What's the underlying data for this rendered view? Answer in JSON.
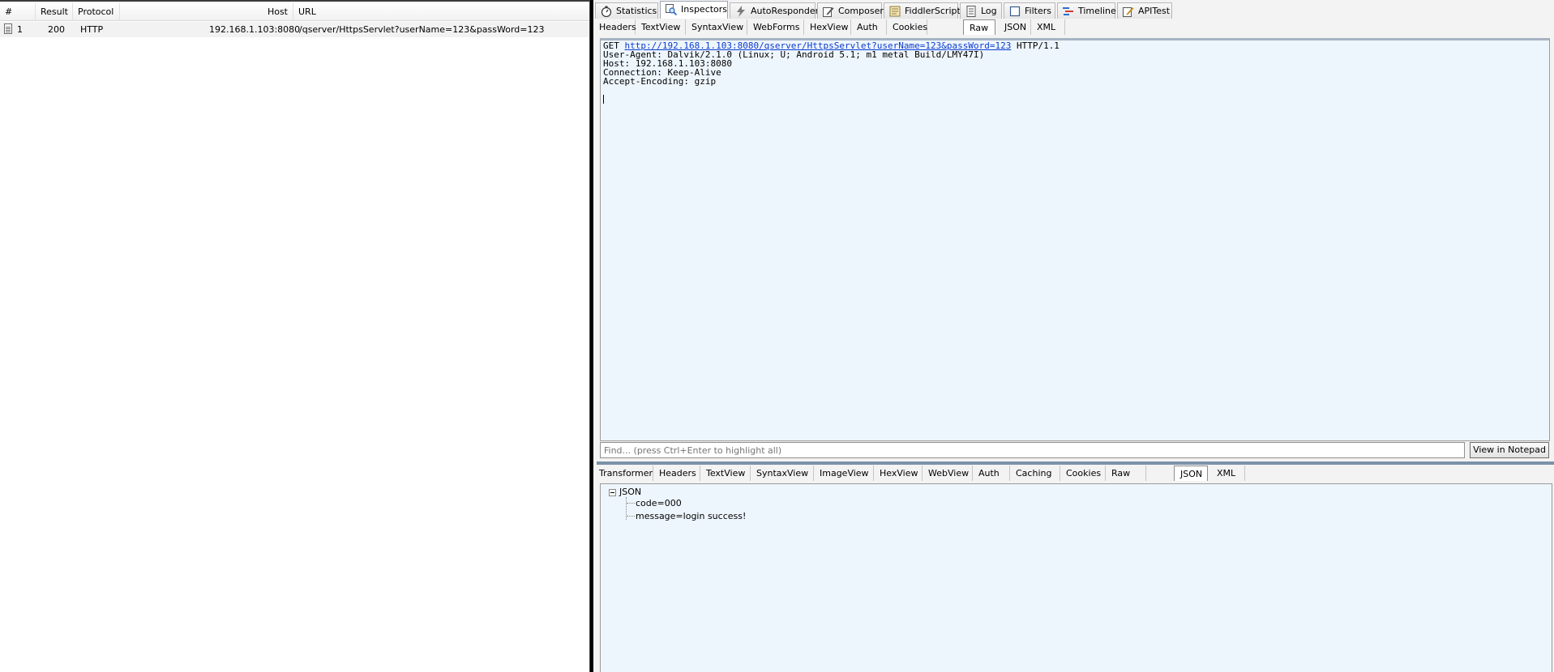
{
  "sessions": {
    "columns": [
      "#",
      "Result",
      "Protocol",
      "Host",
      "URL"
    ],
    "rows": [
      {
        "id": "1",
        "result": "200",
        "protocol": "HTTP",
        "host": "192.168.1.103:8080",
        "url": "/qserver/HttpsServlet?userName=123&passWord=123",
        "icon": "document-icon"
      }
    ]
  },
  "main_tabs": [
    {
      "label": "Statistics",
      "icon": "stopwatch-icon"
    },
    {
      "label": "Inspectors",
      "icon": "magnifier-icon",
      "active": true
    },
    {
      "label": "AutoResponder",
      "icon": "lightning-icon"
    },
    {
      "label": "Composer",
      "icon": "pencil-icon"
    },
    {
      "label": "FiddlerScript",
      "icon": "script-icon"
    },
    {
      "label": "Log",
      "icon": "log-icon"
    },
    {
      "label": "Filters",
      "icon": "checkbox-icon"
    },
    {
      "label": "Timeline",
      "icon": "timeline-icon"
    },
    {
      "label": "APITest",
      "icon": "edit-icon"
    }
  ],
  "request": {
    "tabs": [
      "Headers",
      "TextView",
      "SyntaxView",
      "WebForms",
      "HexView",
      "Auth",
      "Cookies",
      "Raw",
      "JSON",
      "XML"
    ],
    "active_tab": "Raw",
    "raw": {
      "method": "GET",
      "url": "http://192.168.1.103:8080/qserver/HttpsServlet?userName=123&passWord=123",
      "version": "HTTP/1.1",
      "headers": [
        "User-Agent: Dalvik/2.1.0 (Linux; U; Android 5.1; m1 metal Build/LMY47I)",
        "Host: 192.168.1.103:8080",
        "Connection: Keep-Alive",
        "Accept-Encoding: gzip"
      ]
    },
    "find_placeholder": "Find... (press Ctrl+Enter to highlight all)",
    "view_in_notepad": "View in Notepad"
  },
  "response": {
    "tabs": [
      "Transformer",
      "Headers",
      "TextView",
      "SyntaxView",
      "ImageView",
      "HexView",
      "WebView",
      "Auth",
      "Caching",
      "Cookies",
      "Raw",
      "JSON",
      "XML"
    ],
    "active_tab": "JSON",
    "tree": {
      "root": "JSON",
      "children": [
        "code=000",
        "message=login success!"
      ]
    }
  },
  "colors": {
    "accent_link": "#0a3bd1",
    "panel_bg": "#eef6fd",
    "divider": "#7b91a8"
  }
}
